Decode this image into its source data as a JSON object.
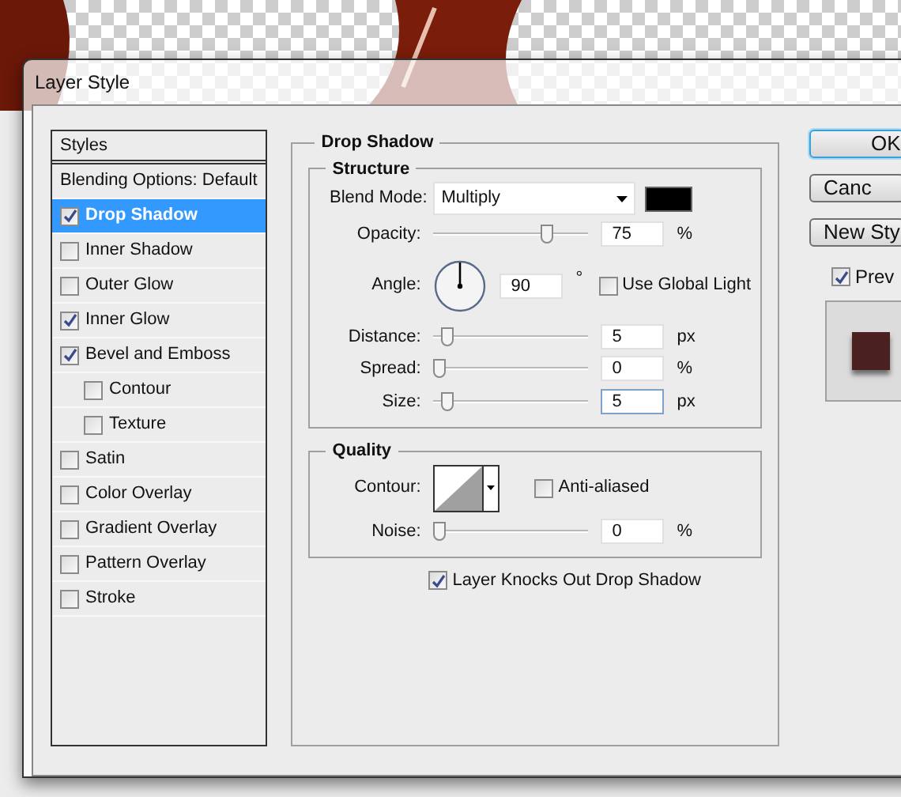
{
  "window": {
    "title": "Layer Style"
  },
  "styles_list": {
    "header": "Styles",
    "items": [
      {
        "kind": "option",
        "label": "Blending Options: Default",
        "selected": false
      },
      {
        "kind": "effect",
        "label": "Drop Shadow",
        "checked": true,
        "selected": true
      },
      {
        "kind": "effect",
        "label": "Inner Shadow",
        "checked": false,
        "selected": false
      },
      {
        "kind": "effect",
        "label": "Outer Glow",
        "checked": false,
        "selected": false
      },
      {
        "kind": "effect",
        "label": "Inner Glow",
        "checked": true,
        "selected": false
      },
      {
        "kind": "effect",
        "label": "Bevel and Emboss",
        "checked": true,
        "selected": false,
        "children": [
          {
            "kind": "effect",
            "label": "Contour",
            "checked": false,
            "selected": false
          },
          {
            "kind": "effect",
            "label": "Texture",
            "checked": false,
            "selected": false
          }
        ]
      },
      {
        "kind": "effect",
        "label": "Satin",
        "checked": false,
        "selected": false
      },
      {
        "kind": "effect",
        "label": "Color Overlay",
        "checked": false,
        "selected": false
      },
      {
        "kind": "effect",
        "label": "Gradient Overlay",
        "checked": false,
        "selected": false
      },
      {
        "kind": "effect",
        "label": "Pattern Overlay",
        "checked": false,
        "selected": false
      },
      {
        "kind": "effect",
        "label": "Stroke",
        "checked": false,
        "selected": false
      }
    ]
  },
  "panel": {
    "title": "Drop Shadow",
    "structure": {
      "title": "Structure",
      "blend_mode": {
        "label": "Blend Mode:",
        "value": "Multiply"
      },
      "rows": [
        {
          "kind": "slider",
          "label": "Opacity:",
          "level": 0.75,
          "value": "75",
          "unit": "%",
          "focused": false
        },
        {
          "kind": "angle",
          "label": "Angle:",
          "value": "90",
          "unit": "°",
          "global_light": {
            "label": "Use Global Light",
            "checked": false
          }
        },
        {
          "kind": "slider",
          "label": "Distance:",
          "level": 0.05,
          "value": "5",
          "unit": "px",
          "focused": false
        },
        {
          "kind": "slider",
          "label": "Spread:",
          "level": 0,
          "value": "0",
          "unit": "%",
          "focused": false
        },
        {
          "kind": "slider",
          "label": "Size:",
          "level": 0.05,
          "value": "5",
          "unit": "px",
          "focused": true
        }
      ]
    },
    "quality": {
      "title": "Quality",
      "contour": {
        "label": "Contour:",
        "anti_aliased": {
          "label": "Anti-aliased",
          "checked": false
        }
      },
      "noise": {
        "label": "Noise:",
        "level": 0,
        "value": "0",
        "unit": "%"
      }
    },
    "knockout": {
      "label": "Layer Knocks Out Drop Shadow",
      "checked": true
    }
  },
  "buttons": [
    {
      "label": "OK",
      "default": true
    },
    {
      "label": "Canc",
      "default": false
    },
    {
      "label": "New Sty",
      "default": false
    }
  ],
  "preview": {
    "label": "Prev",
    "checked": true
  }
}
